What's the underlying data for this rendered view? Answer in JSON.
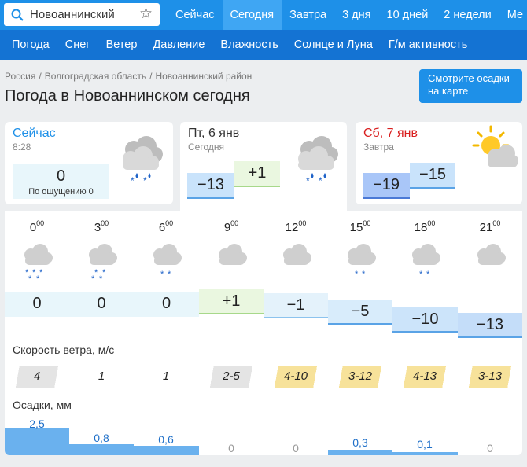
{
  "search": {
    "value": "Новоаннинский",
    "star": "☆"
  },
  "top_tabs": [
    {
      "label": "Сейчас"
    },
    {
      "label": "Сегодня"
    },
    {
      "label": "Завтра"
    },
    {
      "label": "3 дня"
    },
    {
      "label": "10 дней"
    },
    {
      "label": "2 недели"
    },
    {
      "label": "Ме"
    }
  ],
  "active_tab": "Сегодня",
  "sub_nav": [
    {
      "label": "Погода"
    },
    {
      "label": "Снег"
    },
    {
      "label": "Ветер"
    },
    {
      "label": "Давление"
    },
    {
      "label": "Влажность"
    },
    {
      "label": "Солнце и Луна"
    },
    {
      "label": "Г/м активность"
    }
  ],
  "breadcrumb": [
    "Россия",
    "Волгоградская область",
    "Новоаннинский район"
  ],
  "breadcrumb_sep": "/",
  "page_title": "Погода в Новоаннинском сегодня",
  "map_button": {
    "line1": "Смотрите осадки",
    "line2": "на карте"
  },
  "now": {
    "title": "Сейчас",
    "time": "8:28",
    "temp": "0",
    "feels_label": "По ощущению",
    "feels_value": "0",
    "icon": "cloud-snow-icon"
  },
  "today": {
    "title": "Пт, 6 янв",
    "subtitle": "Сегодня",
    "min": "−13",
    "max": "+1",
    "icon": "cloud-snow-icon"
  },
  "tomorrow": {
    "title": "Сб, 7 янв",
    "subtitle": "Завтра",
    "min": "−19",
    "max": "−15",
    "icon": "sun-cloud-icon"
  },
  "hourly": [
    {
      "hour": "0",
      "min": "00",
      "temp": "0",
      "icon": "cloud-heavy-snow-icon",
      "wind": "4",
      "precip": "2,5"
    },
    {
      "hour": "3",
      "min": "00",
      "temp": "0",
      "icon": "cloud-snow-icon",
      "wind": "1",
      "precip": "0,8"
    },
    {
      "hour": "6",
      "min": "00",
      "temp": "0",
      "icon": "cloud-light-snow-icon",
      "wind": "1",
      "precip": "0,6"
    },
    {
      "hour": "9",
      "min": "00",
      "temp": "+1",
      "icon": "cloud-icon",
      "wind": "2-5",
      "precip": "0"
    },
    {
      "hour": "12",
      "min": "00",
      "temp": "−1",
      "icon": "cloud-icon",
      "wind": "4-10",
      "precip": "0"
    },
    {
      "hour": "15",
      "min": "00",
      "temp": "−5",
      "icon": "cloud-light-snow-icon",
      "wind": "3-12",
      "precip": "0,3"
    },
    {
      "hour": "18",
      "min": "00",
      "temp": "−10",
      "icon": "cloud-light-snow-icon",
      "wind": "4-13",
      "precip": "0,1"
    },
    {
      "hour": "21",
      "min": "00",
      "temp": "−13",
      "icon": "cloud-icon",
      "wind": "3-13",
      "precip": "0"
    }
  ],
  "wind_label": "Скорость ветра, м/с",
  "precip_label": "Осадки, мм",
  "colors": {
    "brand": "#1e90e8",
    "nav": "#1473d3",
    "precip": "#5aa8ec",
    "wind_calm": "#e4e4e4",
    "wind_gust": "#f7e29a"
  }
}
